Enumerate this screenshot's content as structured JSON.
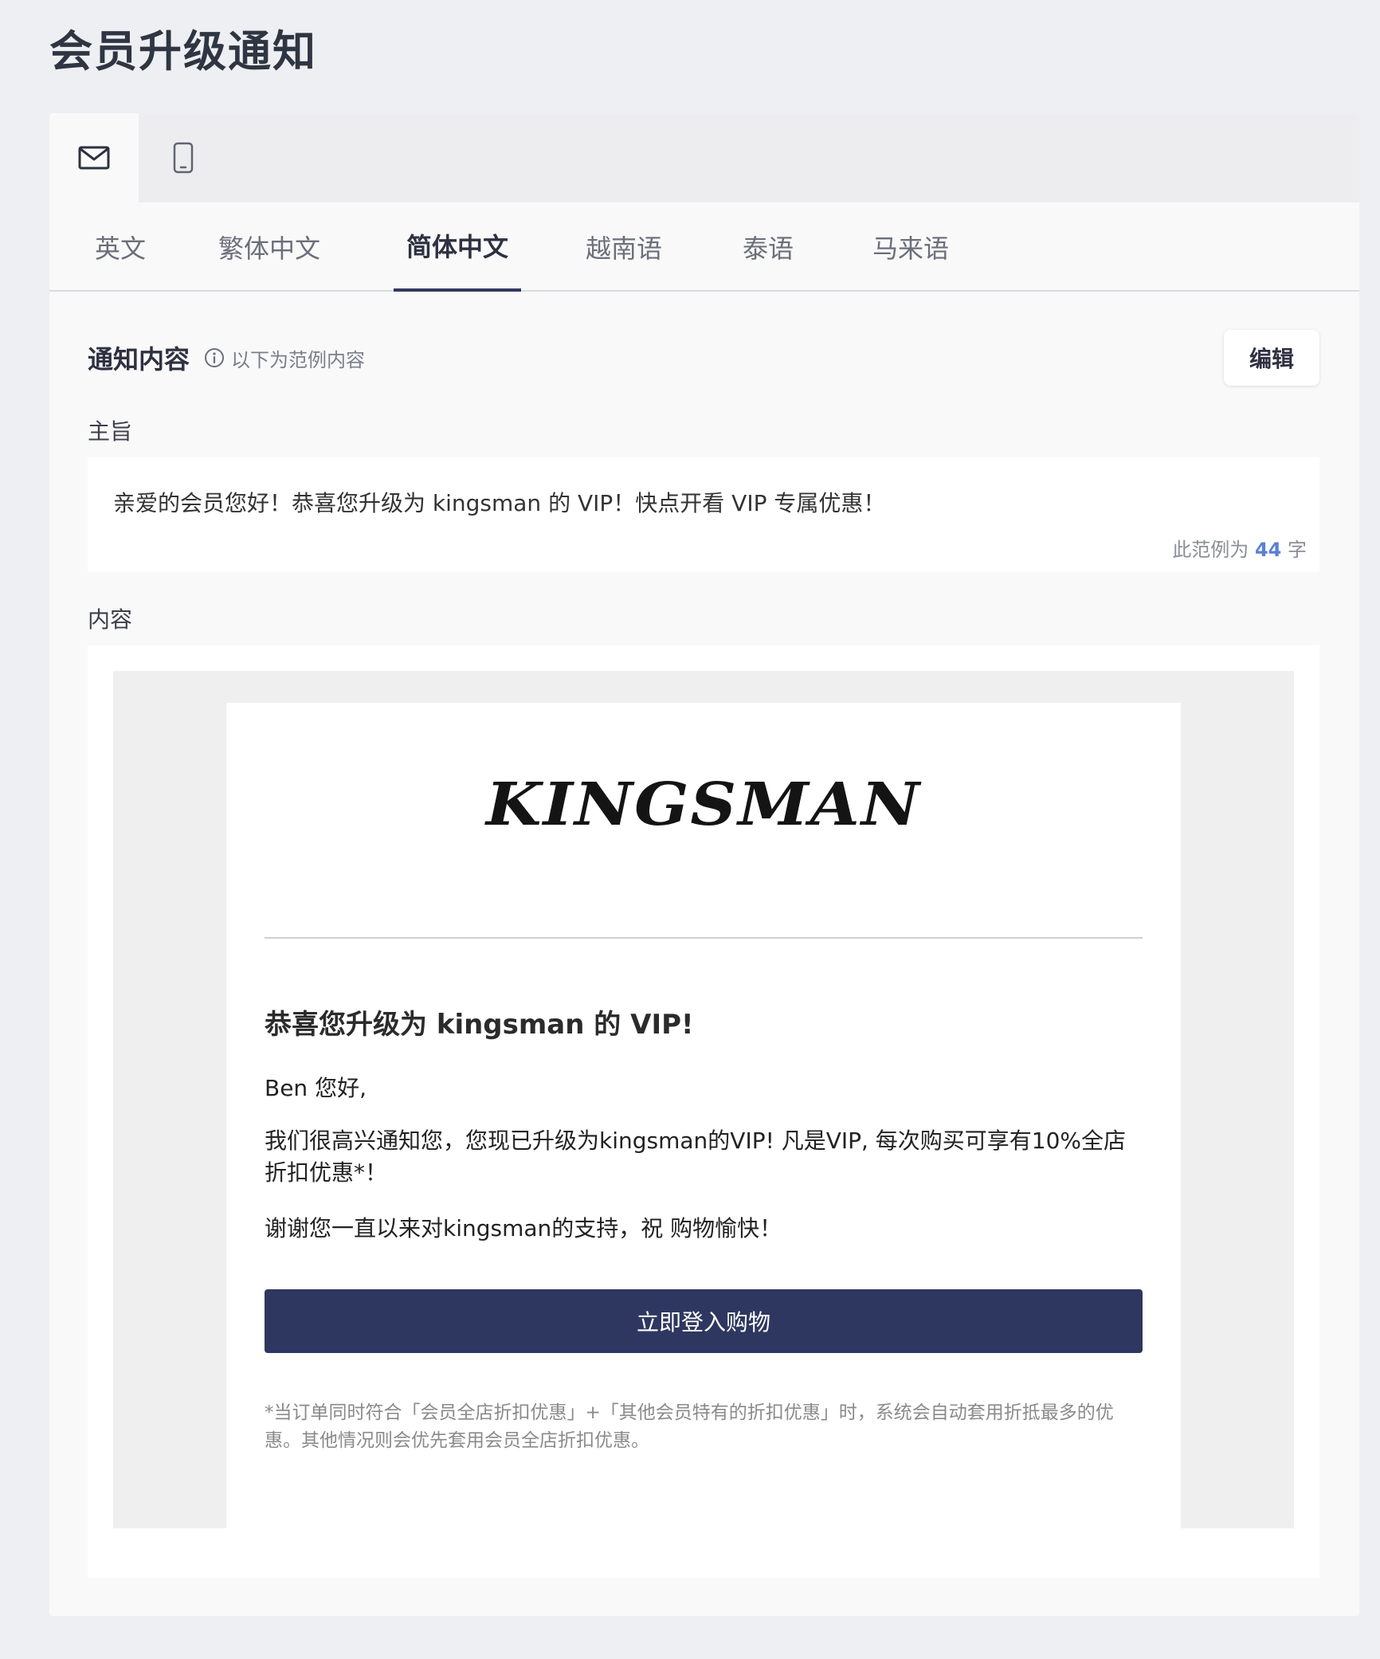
{
  "page": {
    "title": "会员升级通知"
  },
  "channel_tabs": [
    {
      "icon": "mail-icon",
      "active": true
    },
    {
      "icon": "mobile-phone-icon",
      "active": false
    }
  ],
  "language_tabs": [
    {
      "label": "英文",
      "active": false
    },
    {
      "label": "繁体中文",
      "active": false
    },
    {
      "label": "简体中文",
      "active": true
    },
    {
      "label": "越南语",
      "active": false
    },
    {
      "label": "泰语",
      "active": false
    },
    {
      "label": "马来语",
      "active": false
    }
  ],
  "notification": {
    "section_title": "通知内容",
    "hint": "以下为范例内容",
    "edit_label": "编辑",
    "subject_label": "主旨",
    "subject_text": "亲爱的会员您好！恭喜您升级为 kingsman 的 VIP！快点开看 VIP 专属优惠！",
    "char_count_prefix": "此范例为",
    "char_count_value": "44",
    "char_count_suffix": "字",
    "content_label": "内容"
  },
  "email": {
    "logo_text": "KINGSMAN",
    "heading": "恭喜您升级为 kingsman 的 VIP!",
    "greeting": "Ben 您好,",
    "paragraph": "我们很高兴通知您，您现已升级为kingsman的VIP! 凡是VIP, 每次购买可享有10%全店折扣优惠*！",
    "thanks": "谢谢您一直以来对kingsman的支持，祝 购物愉快！",
    "cta_label": "立即登入购物",
    "footnote": "*当订单同时符合「会员全店折扣优惠」+「其他会员特有的折扣优惠」时，系统会自动套用折抵最多的优惠。其他情况则会优先套用会员全店折扣优惠。"
  },
  "colors": {
    "accent": "#323a5f",
    "cta": "#2e3760",
    "count": "#5b7fd6",
    "page_bg": "#eeeff2"
  }
}
